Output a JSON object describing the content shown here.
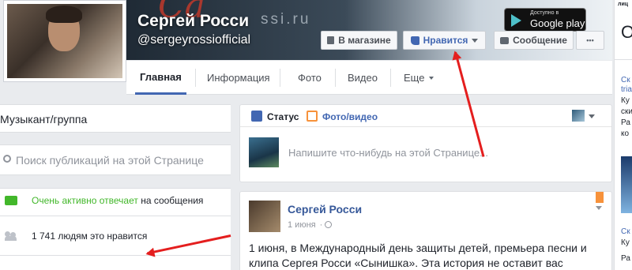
{
  "page": {
    "name": "Сергей Росси",
    "username": "@sergeyrossiofficial",
    "cover_domain_text": "ssi.ru",
    "google_play": {
      "line1": "Доступно в",
      "line2": "Google play"
    }
  },
  "actions": {
    "shop": "В магазине",
    "like": "Нравится",
    "message": "Сообщение",
    "more": "•••"
  },
  "tabs": [
    "Главная",
    "Информация",
    "Фото",
    "Видео",
    "Еще"
  ],
  "sidebar": {
    "category": "Музыкант/группа",
    "search_placeholder": "Поиск публикаций на этой Странице",
    "responsiveness_highlight": "Очень активно отвечает",
    "responsiveness_rest": " на сообщения",
    "likes": "1 741 людям это нравится"
  },
  "composer": {
    "tab_status": "Статус",
    "tab_photo": "Фото/видео",
    "placeholder": "Напишите что-нибудь на этой Странице..."
  },
  "post": {
    "author": "Сергей Росси",
    "date": "1 июня",
    "text": "1 июня, в Международный день защиты детей, премьера песни и клипа Сергея Росси «Сынишка». Эта история не оставит вас"
  },
  "right_strip": {
    "texts": [
      "лиц",
      "Ск",
      "tria",
      "Ку",
      "ски",
      "Ра",
      "ко",
      "Ск",
      "Ку",
      "Ра"
    ]
  },
  "colors": {
    "brand_blue": "#4267b2",
    "green": "#42b72a",
    "arrow_red": "#e41e1e"
  }
}
